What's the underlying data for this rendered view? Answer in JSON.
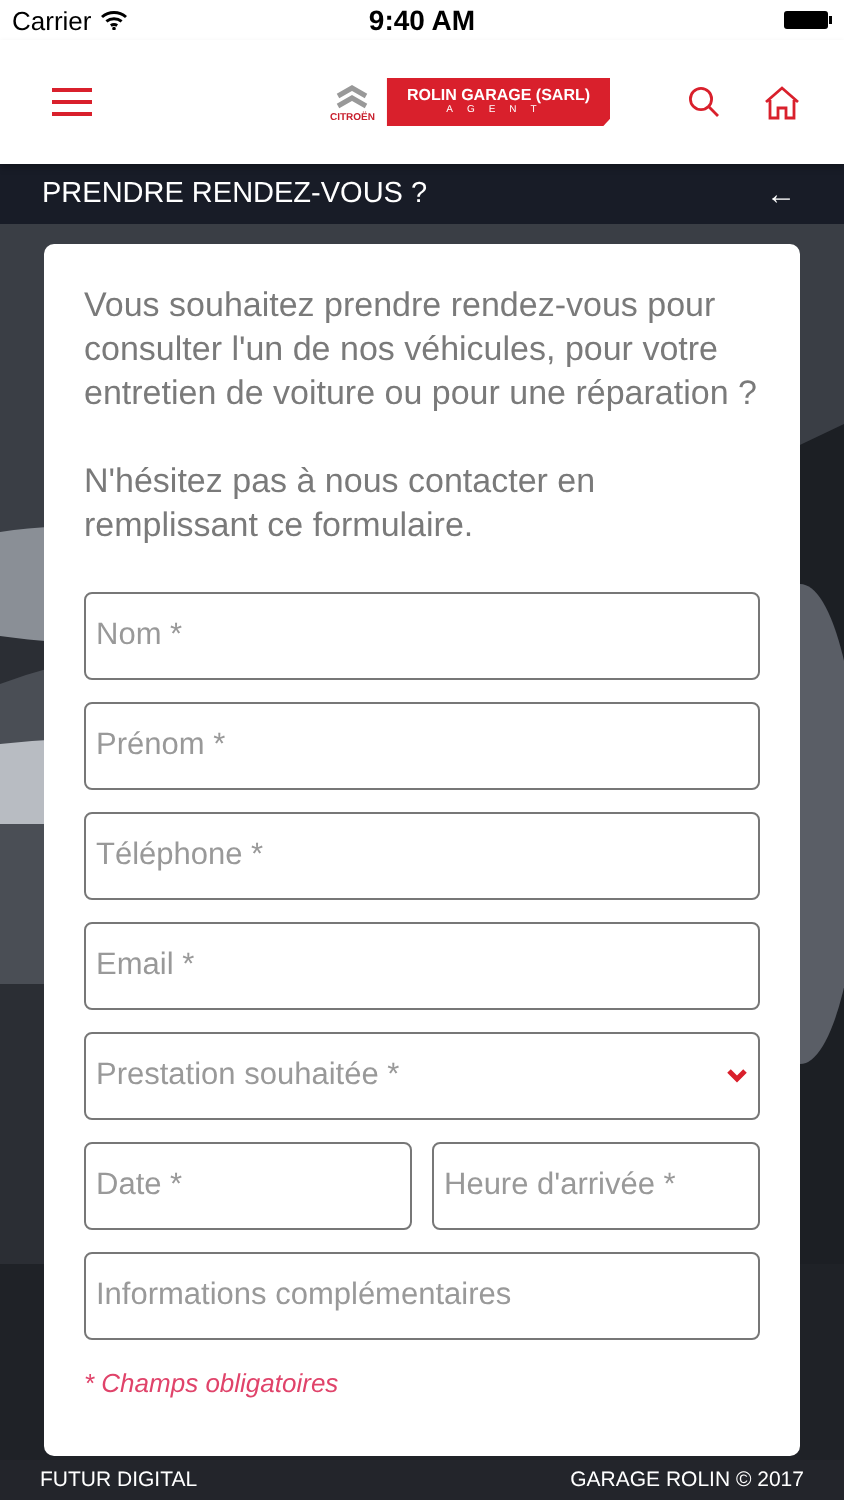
{
  "status_bar": {
    "carrier": "Carrier",
    "time": "9:40 AM"
  },
  "header": {
    "brand": "CITROËN",
    "dealer": "ROLIN GARAGE (SARL)",
    "dealer_role": "AGENT"
  },
  "title_bar": {
    "title": "PRENDRE RENDEZ-VOUS ?",
    "back": "←"
  },
  "form": {
    "intro": [
      "Vous souhaitez prendre rendez-vous pour consulter l'un de nos véhicules, pour votre entretien de voiture ou pour une réparation ?",
      " N'hésitez pas à nous contacter en remplissant ce formulaire."
    ],
    "fields": [
      {
        "kind": "text",
        "placeholder": "Nom *"
      },
      {
        "kind": "text",
        "placeholder": "Prénom *"
      },
      {
        "kind": "text",
        "placeholder": "Téléphone *"
      },
      {
        "kind": "text",
        "placeholder": "Email *"
      },
      {
        "kind": "select",
        "placeholder": "Prestation souhaitée *"
      },
      {
        "kind": "pair",
        "fields": [
          {
            "kind": "text",
            "placeholder": "Date *"
          },
          {
            "kind": "text",
            "placeholder": "Heure d'arrivée *"
          }
        ]
      },
      {
        "kind": "text",
        "placeholder": "Informations complémentaires"
      }
    ],
    "required_note": "* Champs obligatoires"
  },
  "footer": {
    "left": "FUTUR DIGITAL",
    "right": "GARAGE ROLIN © 2017"
  }
}
